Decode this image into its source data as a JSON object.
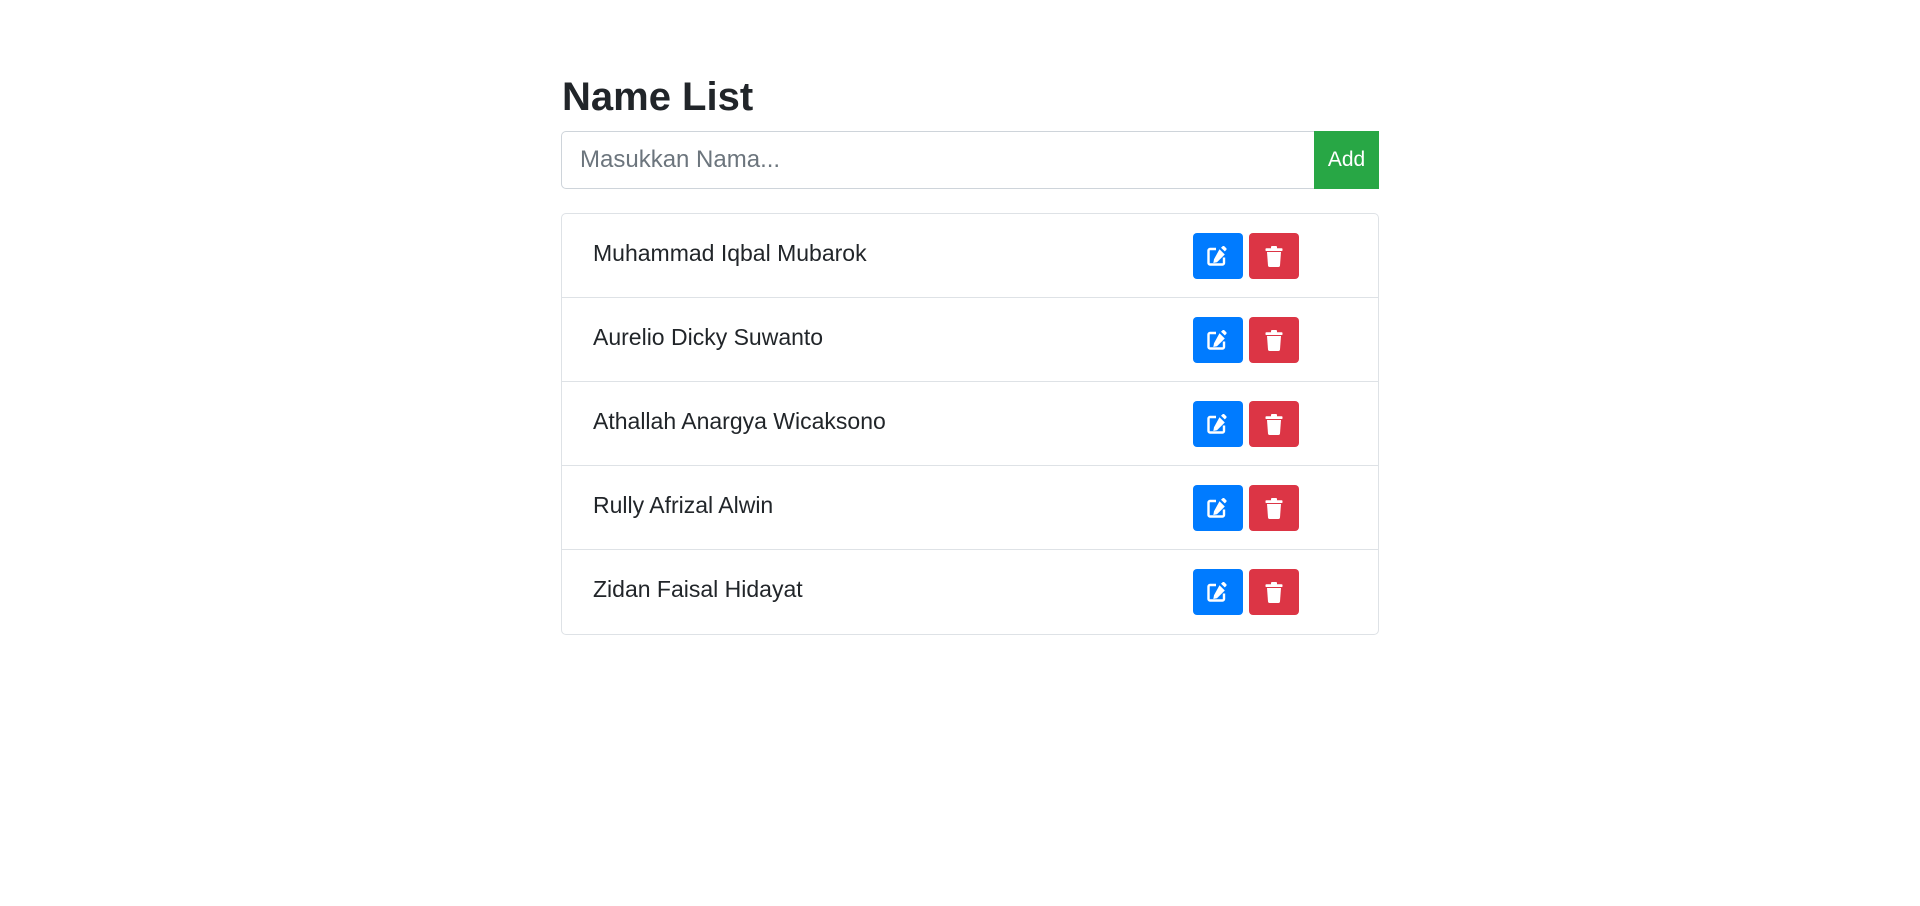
{
  "page": {
    "title": "Name List"
  },
  "form": {
    "placeholder": "Masukkan Nama...",
    "value": "",
    "add_label": "Add"
  },
  "names": [
    {
      "name": "Muhammad Iqbal Mubarok"
    },
    {
      "name": "Aurelio Dicky Suwanto"
    },
    {
      "name": "Athallah Anargya Wicaksono"
    },
    {
      "name": "Rully Afrizal Alwin"
    },
    {
      "name": "Zidan Faisal Hidayat"
    }
  ],
  "icons": {
    "edit": "edit-icon",
    "delete": "trash-icon"
  },
  "colors": {
    "add": "#28a745",
    "edit": "#007bff",
    "delete": "#dc3545"
  }
}
